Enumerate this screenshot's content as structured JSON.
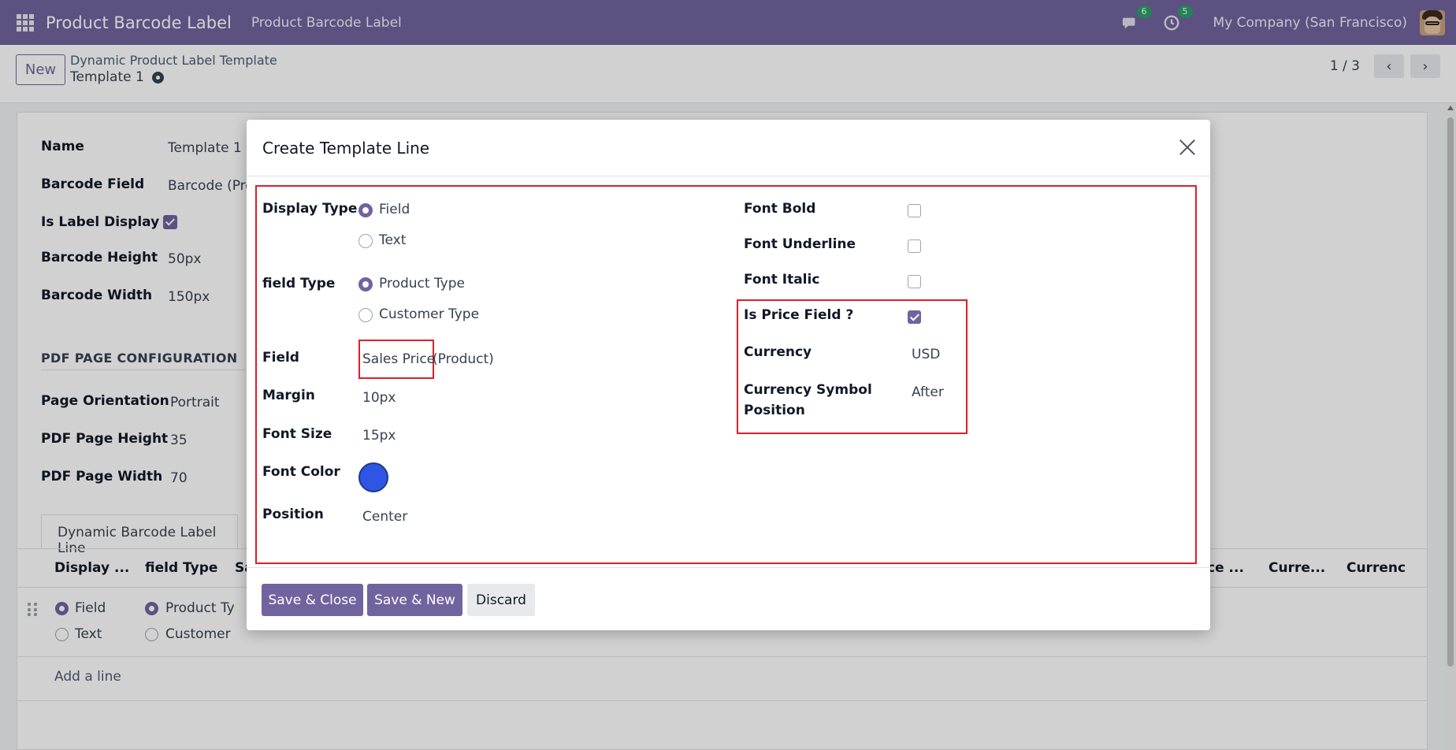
{
  "navbar": {
    "app_title": "Product Barcode Label",
    "menu_item": "Product Barcode Label",
    "messages_count": "6",
    "activities_count": "5",
    "company": "My Company (San Francisco)"
  },
  "control_panel": {
    "new_button": "New",
    "breadcrumb_parent": "Dynamic Product Label Template",
    "record_name": "Template 1",
    "pager": "1 / 3"
  },
  "form": {
    "name_label": "Name",
    "name_value": "Template 1",
    "barcode_field_label": "Barcode Field",
    "barcode_field_value": "Barcode (Pro",
    "is_label_display_label": "Is Label Display ?",
    "is_label_display_checked": true,
    "barcode_height_label": "Barcode Height",
    "barcode_height_value": "50px",
    "barcode_width_label": "Barcode Width",
    "barcode_width_value": "150px",
    "pdf_section_title": "PDF PAGE CONFIGURATION",
    "page_orientation_label": "Page Orientation",
    "page_orientation_value": "Portrait",
    "pdf_page_height_label": "PDF Page Height",
    "pdf_page_height_value": "35",
    "pdf_page_width_label": "PDF Page Width",
    "pdf_page_width_value": "70",
    "tab_label": "Dynamic Barcode Label Line",
    "table_headers": [
      "Display ...",
      "field Type",
      "Sa",
      "ce ...",
      "Curre...",
      "Currenc"
    ],
    "row_display_options": [
      "Field",
      "Text"
    ],
    "row_field_type_options": [
      "Product Ty",
      "Customer"
    ],
    "add_line": "Add a line"
  },
  "modal": {
    "title": "Create Template Line",
    "display_type_label": "Display Type",
    "display_type_options": [
      "Field",
      "Text"
    ],
    "display_type_selected": "Field",
    "field_type_label": "field Type",
    "field_type_options": [
      "Product Type",
      "Customer Type"
    ],
    "field_type_selected": "Product Type",
    "field_label": "Field",
    "field_value_main": "Sales Price",
    "field_value_model": "(Product)",
    "margin_label": "Margin",
    "margin_value": "10px",
    "font_size_label": "Font Size",
    "font_size_value": "15px",
    "font_color_label": "Font Color",
    "font_color_value": "#2f55e4",
    "position_label": "Position",
    "position_value": "Center",
    "font_bold_label": "Font Bold",
    "font_bold_checked": false,
    "font_underline_label": "Font Underline",
    "font_underline_checked": false,
    "font_italic_label": "Font Italic",
    "font_italic_checked": false,
    "is_price_field_label": "Is Price Field ?",
    "is_price_field_checked": true,
    "currency_label": "Currency",
    "currency_value": "USD",
    "currency_symbol_position_label_line1": "Currency Symbol",
    "currency_symbol_position_label_line2": "Position",
    "currency_symbol_position_value": "After",
    "save_close": "Save & Close",
    "save_new": "Save & New",
    "discard": "Discard"
  },
  "colors": {
    "brand": "#71639e",
    "highlight_border": "#e11d2a"
  }
}
